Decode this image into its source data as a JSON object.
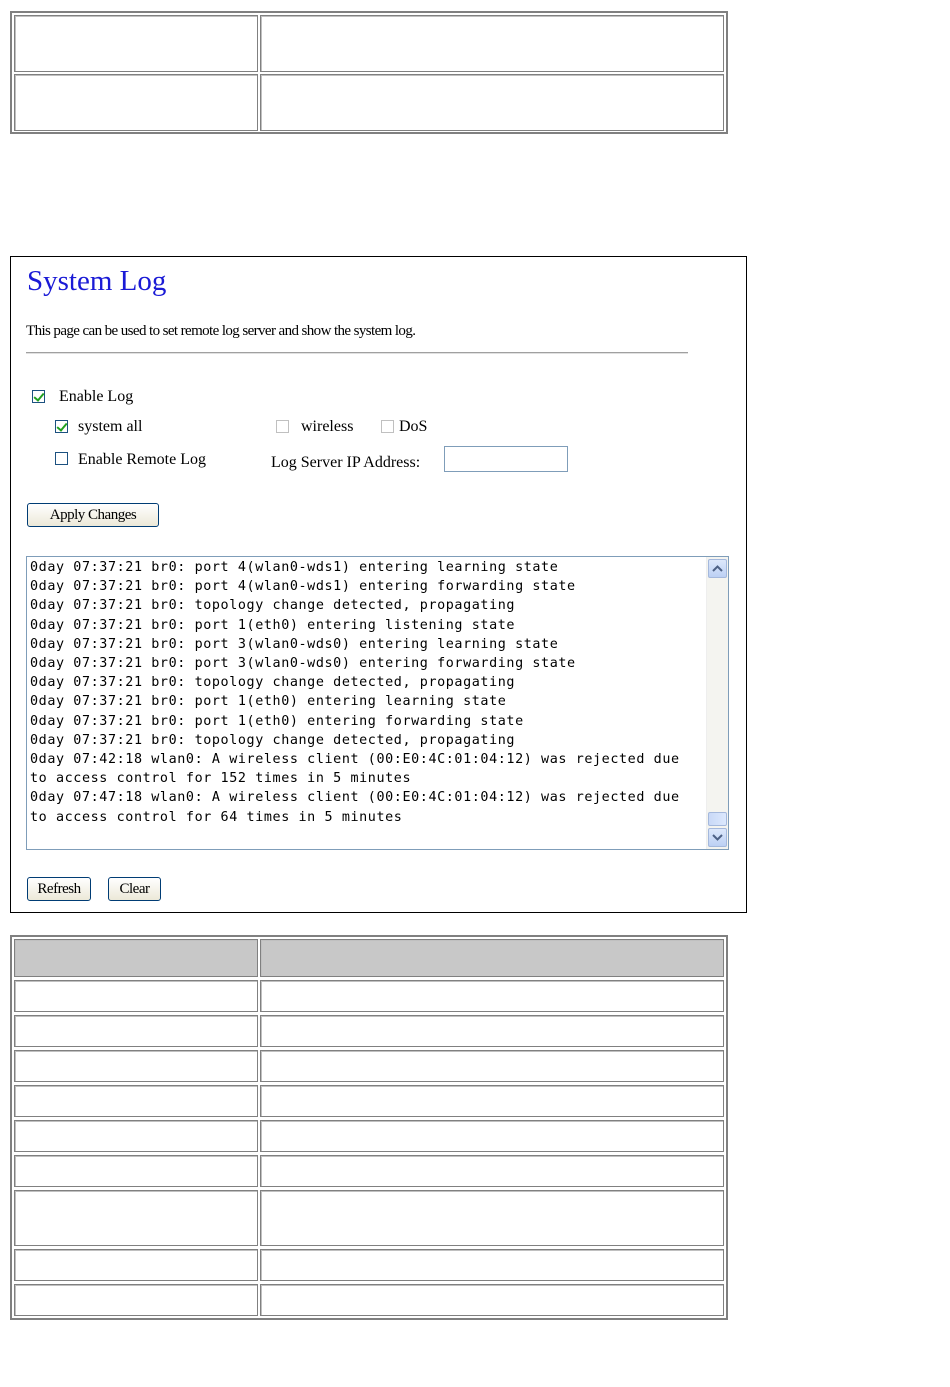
{
  "system_log": {
    "title": "System Log",
    "description": "This page can be used to set remote log server and show the system log.",
    "enable_log": {
      "label": "Enable Log",
      "checked": true
    },
    "system_all": {
      "label": "system all",
      "checked": true
    },
    "wireless": {
      "label": "wireless",
      "checked": false
    },
    "dos": {
      "label": "DoS",
      "checked": false
    },
    "enable_remote_log": {
      "label": "Enable Remote Log",
      "checked": false
    },
    "log_server_ip": {
      "label": "Log Server IP Address:",
      "value": ""
    },
    "apply_button": "Apply Changes",
    "refresh_button": "Refresh",
    "clear_button": "Clear",
    "log_lines": [
      "0day 07:37:21 br0: port 4(wlan0-wds1) entering learning state",
      "0day 07:37:21 br0: port 4(wlan0-wds1) entering forwarding state",
      "0day 07:37:21 br0: topology change detected, propagating",
      "0day 07:37:21 br0: port 1(eth0) entering listening state",
      "0day 07:37:21 br0: port 3(wlan0-wds0) entering learning state",
      "0day 07:37:21 br0: port 3(wlan0-wds0) entering forwarding state",
      "0day 07:37:21 br0: topology change detected, propagating",
      "0day 07:37:21 br0: port 1(eth0) entering learning state",
      "0day 07:37:21 br0: port 1(eth0) entering forwarding state",
      "0day 07:37:21 br0: topology change detected, propagating",
      "0day 07:42:18 wlan0: A wireless client (00:E0:4C:01:04:12) was rejected due to access control for 152 times in 5 minutes",
      "0day 07:47:18 wlan0: A wireless client (00:E0:4C:01:04:12) was rejected due to access control for 64 times in 5 minutes"
    ]
  }
}
